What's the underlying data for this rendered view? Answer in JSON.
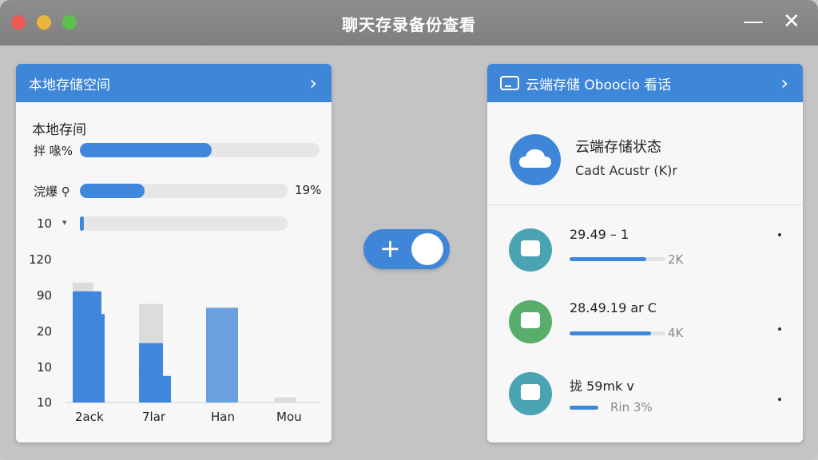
{
  "window": {
    "title": "聊天存录备份查看",
    "minimize": "—",
    "close": "✕"
  },
  "left_panel": {
    "header": "本地存储空间",
    "section_title": "本地存间",
    "rows": [
      {
        "label": "拌 喙%",
        "percent": 55,
        "value_text": ""
      },
      {
        "label": "浣爆 ⚲",
        "percent": 31,
        "value_text": "19%"
      },
      {
        "label": "10",
        "percent": 2,
        "value_text": ""
      }
    ],
    "row3_caret": "▾",
    "chart": {
      "y_ticks": [
        "120",
        "90",
        "20",
        "10",
        "10"
      ],
      "x_labels": [
        "2ack",
        "7lar",
        "Han",
        "Mou"
      ]
    }
  },
  "chart_data": {
    "type": "bar",
    "categories": [
      "2ack",
      "7lar",
      "Han",
      "Mou"
    ],
    "ytick_labels": [
      "120",
      "90",
      "20",
      "10",
      "10"
    ],
    "series": [
      {
        "values": [
          105,
          88,
          65,
          14
        ]
      },
      {
        "values": [
          98,
          57,
          85,
          6
        ]
      },
      {
        "values": [
          80,
          31,
          0,
          0
        ]
      }
    ],
    "ylim": [
      10,
      120
    ],
    "grid": false
  },
  "toggle": {
    "plus": "+"
  },
  "right_panel": {
    "header": "云端存储 Oboocio 看话",
    "status_title": "云端存储状态",
    "status_sub": "Cadt Acustr (K)r",
    "items": [
      {
        "title": "29.49   –  1",
        "size": "2K",
        "progress": 0.8,
        "icon": "calendar-icon",
        "icon_color": "#4aa3b3"
      },
      {
        "title": "28.49.19 ar C",
        "size": "4K",
        "progress": 0.85,
        "icon": "chat-icon",
        "icon_color": "#57ad69"
      },
      {
        "title": "拢 59mk v",
        "size": "Rin 3%",
        "progress": 0.3,
        "icon": "message-icon",
        "icon_color": "#4aa3b3"
      }
    ]
  },
  "colors": {
    "accent": "#3d86d8",
    "titlebar": "#878787",
    "bar_light": "#dcdcdc"
  }
}
